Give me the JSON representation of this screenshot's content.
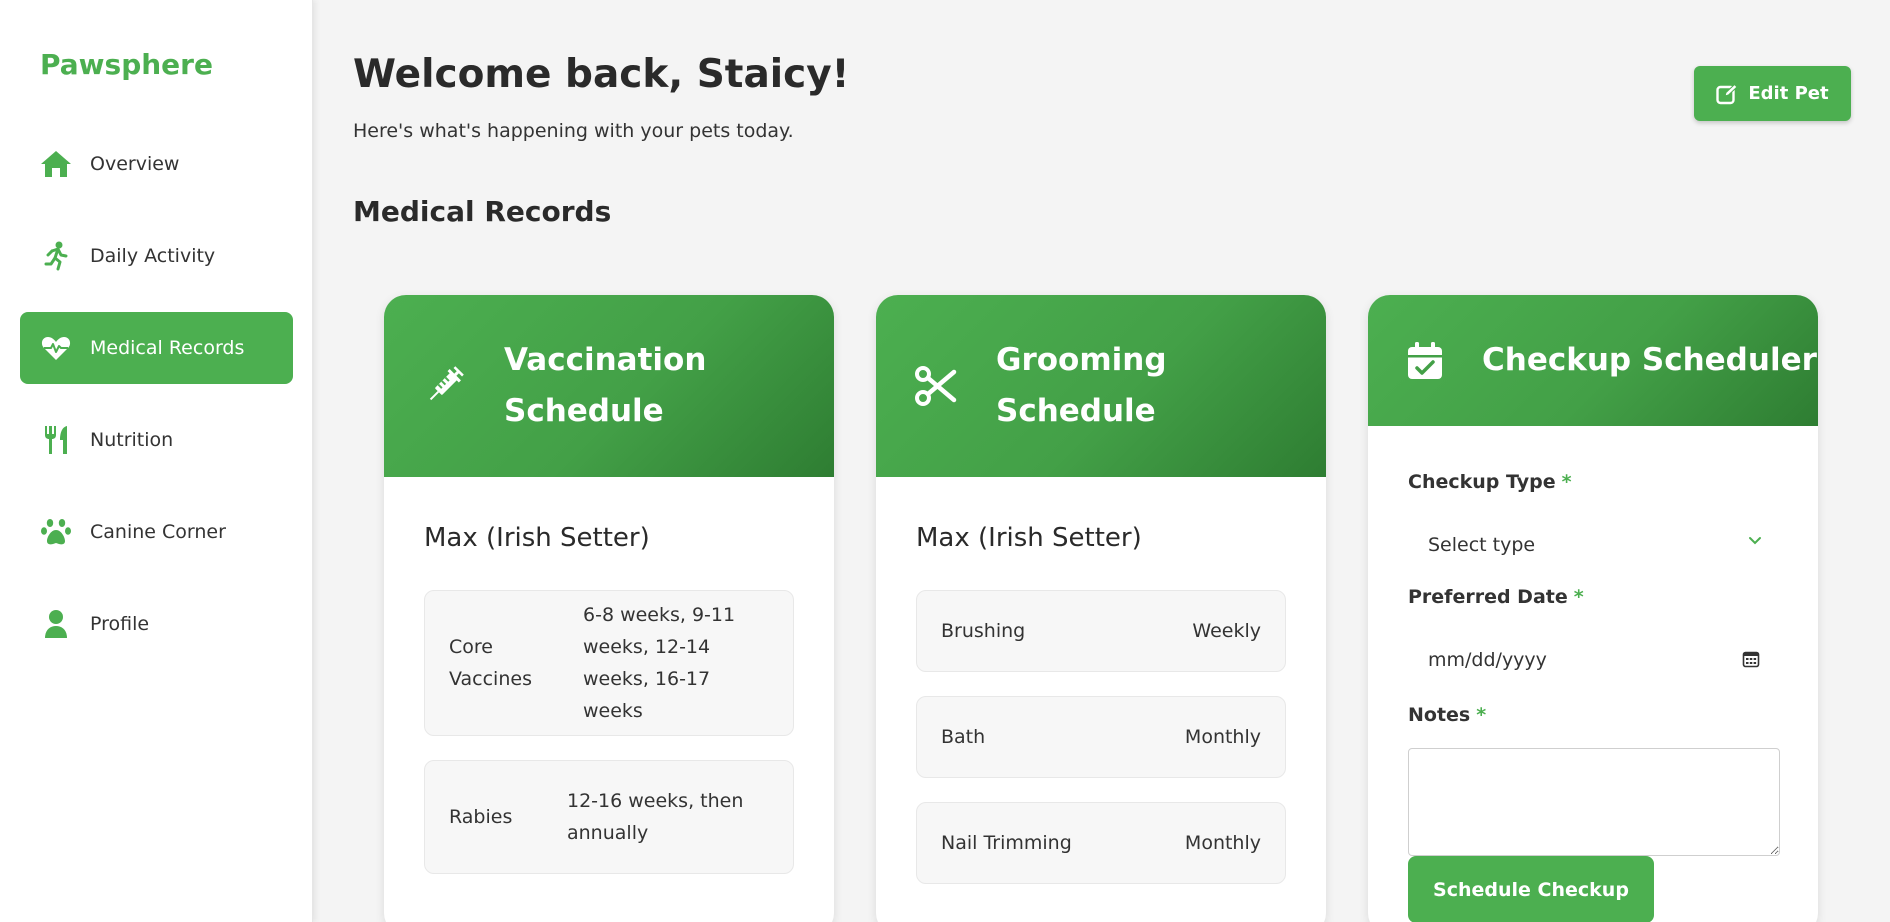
{
  "brand": "Pawsphere",
  "colors": {
    "accent": "#4caf50",
    "accent_dark": "#2e7d32",
    "background": "#f4f4f4"
  },
  "nav": [
    {
      "label": "Overview",
      "icon": "home-icon",
      "active": false
    },
    {
      "label": "Daily Activity",
      "icon": "running-icon",
      "active": false
    },
    {
      "label": "Medical Records",
      "icon": "heart-pulse-icon",
      "active": true
    },
    {
      "label": "Nutrition",
      "icon": "utensils-icon",
      "active": false
    },
    {
      "label": "Canine Corner",
      "icon": "paw-icon",
      "active": false
    },
    {
      "label": "Profile",
      "icon": "user-icon",
      "active": false
    }
  ],
  "header": {
    "title": "Welcome back, Staicy!",
    "subtitle": "Here's what's happening with your pets today.",
    "edit_label": "Edit Pet"
  },
  "section_title": "Medical Records",
  "vaccination": {
    "title": "Vaccination Schedule",
    "icon": "syringe-icon",
    "pet": "Max (Irish Setter)",
    "rows": [
      {
        "name": "Core Vaccines",
        "value": "6-8 weeks, 9-11 weeks, 12-14 weeks, 16-17 weeks"
      },
      {
        "name": "Rabies",
        "value": "12-16 weeks, then annually"
      }
    ]
  },
  "grooming": {
    "title": "Grooming Schedule",
    "icon": "scissors-icon",
    "pet": "Max (Irish Setter)",
    "rows": [
      {
        "name": "Brushing",
        "value": "Weekly"
      },
      {
        "name": "Bath",
        "value": "Monthly"
      },
      {
        "name": "Nail Trimming",
        "value": "Monthly"
      }
    ]
  },
  "scheduler": {
    "title": "Checkup Scheduler",
    "icon": "calendar-check-icon",
    "type_label": "Checkup Type",
    "type_value": "Select type",
    "date_label": "Preferred Date",
    "date_placeholder": "mm/dd/yyyy",
    "notes_label": "Notes",
    "required_mark": "*",
    "button_label": "Schedule Checkup"
  }
}
